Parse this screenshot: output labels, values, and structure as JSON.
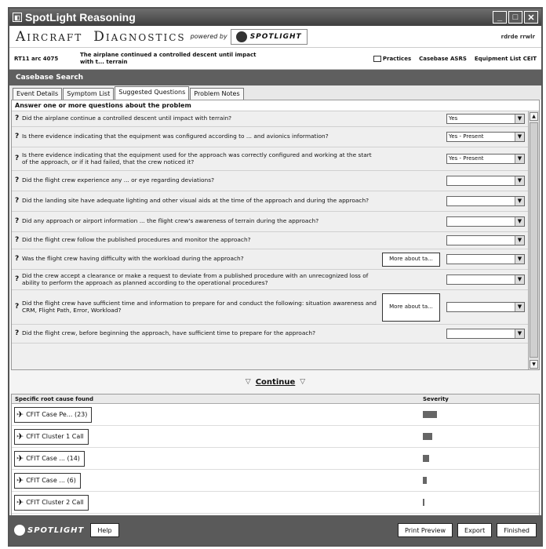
{
  "window": {
    "title": "SpotLight Reasoning"
  },
  "brand": {
    "word1": "Aircraft",
    "word2": "Diagnostics",
    "powered_by": "powered by",
    "logo_word": "SPOTLIGHT",
    "user": "rdrde rrwlr"
  },
  "info": {
    "aircraft": "RT11 arc 4075",
    "problem": "The airplane continued a controlled descent until impact with t... terrain",
    "links": {
      "practices": "Practices",
      "casebase": "Casebase ASRS",
      "equipment": "Equipment List CEIT"
    }
  },
  "section": {
    "title": "Casebase Search"
  },
  "tabs": [
    {
      "label": "Event Details"
    },
    {
      "label": "Symptom List"
    },
    {
      "label": "Suggested Questions"
    },
    {
      "label": "Problem Notes"
    }
  ],
  "questions_panel": {
    "instructions": "Answer one or more questions about the problem",
    "questions": [
      {
        "icon": "?",
        "text": "Did the airplane continue a controlled descent until impact with terrain?",
        "value": "Yes",
        "more": ""
      },
      {
        "icon": "?",
        "text": "Is there evidence indicating that the equipment was configured according to ... and avionics information?",
        "value": "Yes - Present",
        "more": ""
      },
      {
        "icon": "?",
        "text": "Is there evidence indicating that the equipment used for the approach was correctly configured and working at the start of the approach, or if it had failed, that the crew noticed it?",
        "value": "Yes - Present",
        "more": ""
      },
      {
        "icon": "?",
        "text": "Did the flight crew experience any ... or eye regarding deviations?",
        "value": "",
        "more": ""
      },
      {
        "icon": "?",
        "text": "Did the landing site have adequate lighting and other visual aids at the time of the approach and during the approach?",
        "value": "",
        "more": ""
      },
      {
        "icon": "?",
        "text": "Did any approach or airport information ... the flight crew's awareness of terrain during the approach?",
        "value": "",
        "more": ""
      },
      {
        "icon": "?",
        "text": "Did the flight crew follow the published procedures and monitor the approach?",
        "value": "",
        "more": ""
      },
      {
        "icon": "?",
        "text": "Was the flight crew having difficulty with the workload during the approach?",
        "value": "",
        "more": "More about ta..."
      },
      {
        "icon": "?",
        "text": "Did the crew accept a clearance or make a request to deviate from a published procedure with an unrecognized loss of ability to perform the approach as planned according to the operational procedures?",
        "value": "",
        "more": ""
      },
      {
        "icon": "?",
        "text": "Did the flight crew have sufficient time and information to prepare for and conduct the following: situation awareness and CRM, Flight Path, Error, Workload?",
        "value": "",
        "more": "More about ta..."
      },
      {
        "icon": "?",
        "text": "Did the flight crew, before beginning the approach, have sufficient time to prepare for the approach?",
        "value": "",
        "more": ""
      }
    ]
  },
  "continue": {
    "label": "Continue"
  },
  "results": {
    "col_cause": "Specific root cause found",
    "col_severity": "Severity",
    "items": [
      {
        "label": "CFIT Case Pe... (23)",
        "severity": 0.9
      },
      {
        "label": "CFIT Cluster 1 Call",
        "severity": 0.6
      },
      {
        "label": "CFIT Case ... (14)",
        "severity": 0.4
      },
      {
        "label": "CFIT Case ... (6)",
        "severity": 0.25
      },
      {
        "label": "CFIT Cluster 2 Call",
        "severity": 0.05
      }
    ]
  },
  "footer": {
    "logo_word": "SPOTLIGHT",
    "help": "Help",
    "print_preview": "Print Preview",
    "export": "Export",
    "finished": "Finished"
  }
}
